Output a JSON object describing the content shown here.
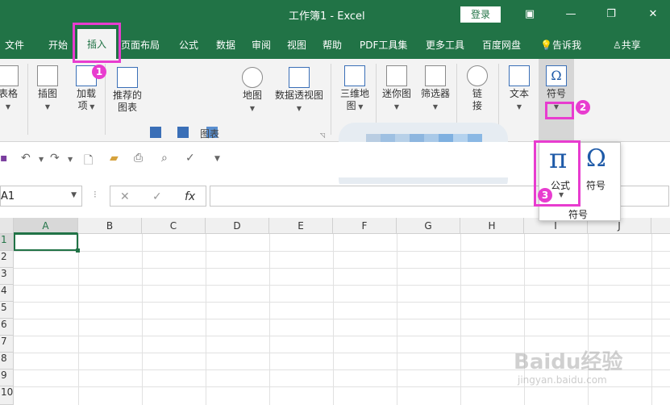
{
  "window": {
    "title": "工作簿1 - Excel",
    "login_label": "登录",
    "controls": [
      "ribbon-display-icon",
      "minimize-icon",
      "restore-icon",
      "close-icon"
    ]
  },
  "menu": {
    "tabs": [
      "文件",
      "开始",
      "插入",
      "页面布局",
      "公式",
      "数据",
      "审阅",
      "视图",
      "帮助",
      "PDF工具集",
      "更多工具",
      "百度网盘"
    ],
    "active": "插入",
    "tell_me": "告诉我",
    "share": "共享"
  },
  "ribbon": {
    "table": "表格",
    "illustrations": "插图",
    "addins_line1": "加载",
    "addins_line2": "项",
    "recommended_line1": "推荐的",
    "recommended_line2": "图表",
    "map": "地图",
    "pivot_chart": "数据透视图",
    "threed_line1": "三维地",
    "threed_line2": "图",
    "sparklines": "迷你图",
    "slicer": "筛选器",
    "link_line1": "链",
    "link_line2": "接",
    "text": "文本",
    "symbols": "符号",
    "charts_group": "图表"
  },
  "popup": {
    "equation": "公式",
    "symbol": "符号",
    "group": "符号"
  },
  "formula_bar": {
    "name_box": "A1",
    "fx": "fx",
    "value": ""
  },
  "grid": {
    "columns": [
      "A",
      "B",
      "C",
      "D",
      "E",
      "F",
      "G",
      "H",
      "I",
      "J"
    ],
    "rows": [
      "1",
      "2",
      "3",
      "4",
      "5",
      "6",
      "7",
      "8",
      "9",
      "10"
    ],
    "selected": "A1"
  },
  "annotations": {
    "step1": "1",
    "step2": "2",
    "step3": "3"
  },
  "watermark": {
    "brand": "Baidu经验",
    "url": "jingyan.baidu.com"
  },
  "colors": {
    "excel_green": "#217346",
    "highlight": "#e83ccf",
    "symbol_blue": "#1e5aa8"
  }
}
